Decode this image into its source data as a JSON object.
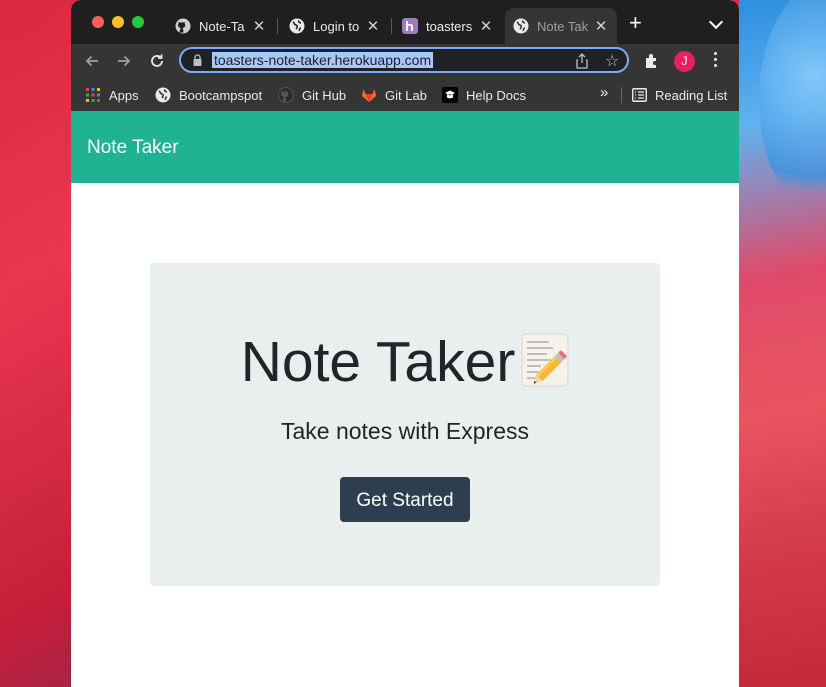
{
  "browser": {
    "tabs": [
      {
        "title": "Note-Ta",
        "favicon": "github-icon"
      },
      {
        "title": "Login to",
        "favicon": "globe-icon"
      },
      {
        "title": "toasters",
        "favicon": "heroku-icon"
      },
      {
        "title": "Note Tak",
        "favicon": "globe-icon",
        "active": true
      }
    ],
    "url": "toasters-note-taker.herokuapp.com",
    "profile_initial": "J",
    "bookmarks": [
      {
        "label": "Apps",
        "icon": "apps-grid-icon"
      },
      {
        "label": "Bootcampspot",
        "icon": "globe-icon"
      },
      {
        "label": "Git Hub",
        "icon": "github-icon"
      },
      {
        "label": "Git Lab",
        "icon": "gitlab-icon"
      },
      {
        "label": "Help Docs",
        "icon": "help-docs-icon"
      }
    ],
    "more_bookmarks": "»",
    "reading_list": "Reading List"
  },
  "page": {
    "brand": "Note Taker",
    "hero_title": "Note Taker",
    "hero_emoji": "memo-icon",
    "hero_subtitle": "Take notes with Express",
    "cta_label": "Get Started",
    "accent_color": "#1fb394",
    "button_color": "#2c3e50"
  }
}
